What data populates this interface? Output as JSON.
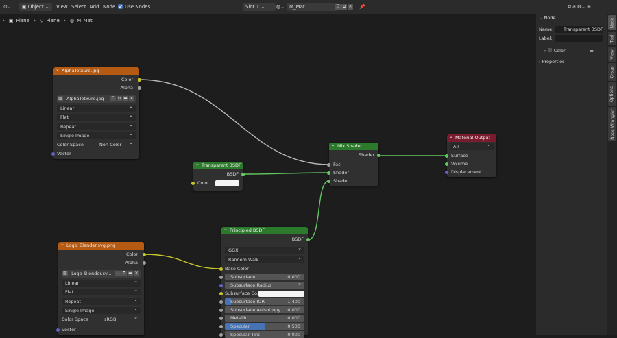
{
  "header": {
    "mode": "Object",
    "menu": [
      "View",
      "Select",
      "Add",
      "Node"
    ],
    "use_nodes_label": "Use Nodes",
    "slot": "Slot 1",
    "material": "M_Mat"
  },
  "breadcrumb": [
    "Plane",
    "Plane",
    "M_Mat"
  ],
  "nodes": {
    "alpha_texture": {
      "title": "AlphaTetxure.jpg",
      "outputs": [
        "Color",
        "Alpha"
      ],
      "image_name": "AlphaTetxure.jpg",
      "interpolation": "Linear",
      "projection": "Flat",
      "extension": "Repeat",
      "source": "Single Image",
      "color_space_label": "Color Space",
      "color_space": "Non-Color",
      "input": "Vector"
    },
    "logo_texture": {
      "title": "Logo_Blender.svg.png",
      "outputs": [
        "Color",
        "Alpha"
      ],
      "image_name": "Logo_Blender.sv...",
      "interpolation": "Linear",
      "projection": "Flat",
      "extension": "Repeat",
      "source": "Single Image",
      "color_space_label": "Color Space",
      "color_space": "sRGB",
      "input": "Vector"
    },
    "transparent_bsdf": {
      "title": "Transparent BSDF",
      "output": "BSDF",
      "input": "Color",
      "color": "#f4f4f4"
    },
    "mix_shader": {
      "title": "Mix Shader",
      "output": "Shader",
      "inputs": [
        "Fac",
        "Shader",
        "Shader"
      ]
    },
    "material_output": {
      "title": "Material Output",
      "target": "All",
      "inputs": [
        "Surface",
        "Volume",
        "Displacement"
      ]
    },
    "principled_bsdf": {
      "title": "Principled BSDF",
      "output": "BSDF",
      "distribution": "GGX",
      "subsurface_method": "Random Walk",
      "base_color": "Base Color",
      "fields": [
        {
          "label": "Subsurface",
          "value": "0.000",
          "fill": 0
        },
        {
          "label": "Subsurface Radius",
          "value": "",
          "fill": 0
        },
        {
          "label": "Subsurface Co...",
          "value": "",
          "fill": 0
        },
        {
          "label": "Subsurface IOR",
          "value": "1.400",
          "fill": 0.08
        },
        {
          "label": "Subsurface Anisotropy",
          "value": "0.000",
          "fill": 0
        },
        {
          "label": "Metallic",
          "value": "0.000",
          "fill": 0
        },
        {
          "label": "Specular",
          "value": "0.500",
          "fill": 0.5
        },
        {
          "label": "Specular Tint",
          "value": "0.000",
          "fill": 0
        }
      ]
    }
  },
  "sidebar": {
    "section": "Node",
    "name_label": "Name:",
    "name_value": "Transparent BSDF",
    "label_label": "Label:",
    "label_value": "",
    "color_label": "Color",
    "properties_label": "Properties",
    "tabs": [
      "Node",
      "Tool",
      "View",
      "Group",
      "Options",
      "Node Wrangler"
    ]
  },
  "colors": {
    "texture_header": "#b55a12",
    "shader_header": "#2c7a2c",
    "output_header": "#7a1c2e",
    "color_socket": "#c7c729",
    "shader_socket": "#63c763",
    "vector_socket": "#6363c7"
  }
}
